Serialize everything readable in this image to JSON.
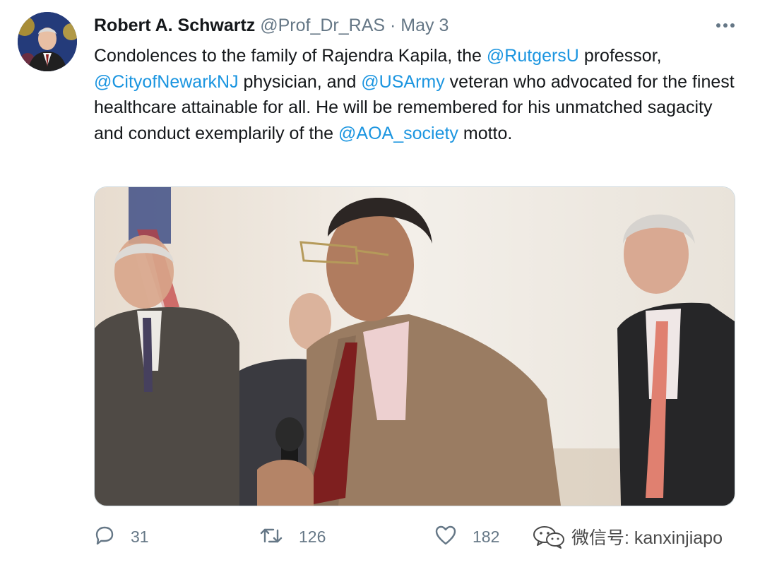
{
  "tweet": {
    "author": {
      "name": "Robert A. Schwartz",
      "handle": "@Prof_Dr_RAS",
      "separator": "·",
      "date": "May 3"
    },
    "text": {
      "p1": "Condolences to the family of Rajendra Kapila, the ",
      "m1": "@RutgersU",
      "p2": " professor, ",
      "m2": "@CityofNewarkNJ",
      "p3": " physician, and ",
      "m3": "@USArmy",
      "p4": " veteran who advocated for the finest healthcare attainable for all. He will be remembered for his unmatched sagacity and conduct exemplarily of the ",
      "m4": "@AOA_society",
      "p5": " motto."
    },
    "actions": {
      "reply_count": "31",
      "retweet_count": "126",
      "like_count": "182"
    }
  },
  "watermark": {
    "text": "微信号: kanxinjiapo"
  },
  "colors": {
    "accent": "#1b95e0",
    "secondary_text": "#657786",
    "primary_text": "#14171a"
  },
  "icons": [
    "more-icon",
    "reply-icon",
    "retweet-icon",
    "like-icon",
    "wechat-icon"
  ]
}
